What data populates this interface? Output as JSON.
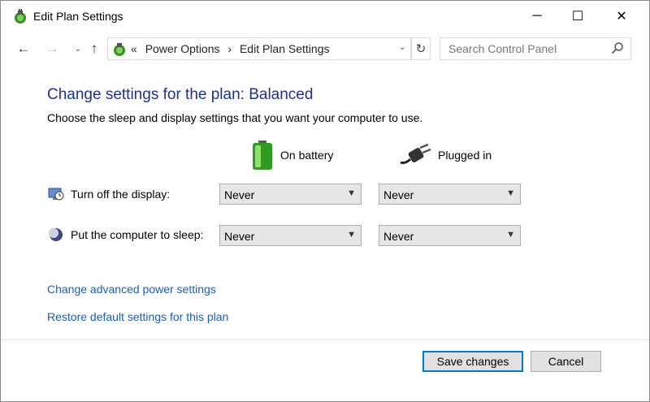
{
  "window": {
    "title": "Edit Plan Settings",
    "controls": {
      "minimize": "─",
      "maximize": "☐",
      "close": "✕"
    }
  },
  "nav": {
    "back": "←",
    "forward": "→",
    "history": "⌄",
    "up": "↑",
    "breadcrumb_prefix": "«",
    "breadcrumb": [
      "Power Options",
      "Edit Plan Settings"
    ],
    "breadcrumb_sep": "›",
    "dropdown": "⌄",
    "refresh": "↻",
    "search_placeholder": "Search Control Panel"
  },
  "main": {
    "heading": "Change settings for the plan: Balanced",
    "description": "Choose the sleep and display settings that you want your computer to use.",
    "columns": {
      "battery": "On battery",
      "plugged": "Plugged in"
    },
    "rows": [
      {
        "label": "Turn off the display:",
        "battery": "Never",
        "plugged": "Never"
      },
      {
        "label": "Put the computer to sleep:",
        "battery": "Never",
        "plugged": "Never"
      }
    ],
    "links": {
      "advanced": "Change advanced power settings",
      "restore": "Restore default settings for this plan"
    }
  },
  "footer": {
    "save": "Save changes",
    "cancel": "Cancel"
  },
  "colors": {
    "heading": "#1e3287",
    "link": "#1a5fb4",
    "accent": "#0078d7"
  },
  "icons": {
    "app": "power-options-icon",
    "battery": "battery-icon",
    "plug": "plug-icon",
    "display": "display-timer-icon",
    "sleep": "sleep-moon-icon"
  }
}
